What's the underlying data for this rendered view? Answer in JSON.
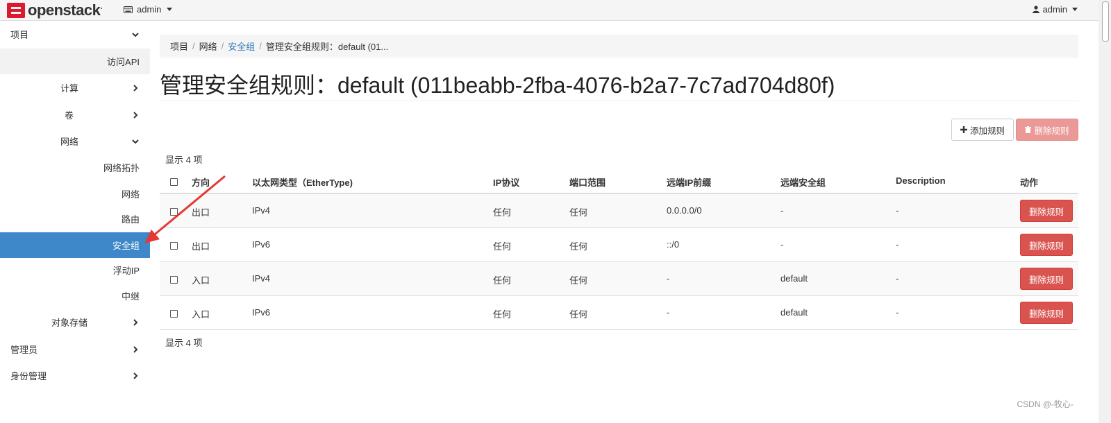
{
  "topbar": {
    "logo_text": "openstack",
    "project": "admin",
    "user": "admin"
  },
  "sidebar": {
    "items": [
      {
        "label": "项目"
      },
      {
        "label": "访问API"
      },
      {
        "label": "计算"
      },
      {
        "label": "卷"
      },
      {
        "label": "网络"
      },
      {
        "label": "网络拓扑"
      },
      {
        "label": "网络"
      },
      {
        "label": "路由"
      },
      {
        "label": "安全组"
      },
      {
        "label": "浮动IP"
      },
      {
        "label": "中继"
      },
      {
        "label": "对象存储"
      },
      {
        "label": "管理员"
      },
      {
        "label": "身份管理"
      }
    ]
  },
  "breadcrumb": {
    "items": [
      "项目",
      "网络",
      "安全组",
      "管理安全组规则：default (01..."
    ]
  },
  "page_title": "管理安全组规则：default (011beabb-2fba-4076-b2a7-7c7ad704d80f)",
  "actions": {
    "add_rule": "添加规则",
    "delete_rules": "删除规则"
  },
  "count_text": "显示 4 项",
  "table": {
    "headers": [
      "方向",
      "以太网类型（EtherType)",
      "IP协议",
      "端口范围",
      "远端IP前缀",
      "远端安全组",
      "Description",
      "动作"
    ],
    "rows": [
      {
        "direction": "出口",
        "ethertype": "IPv4",
        "protocol": "任何",
        "port_range": "任何",
        "remote_ip": "0.0.0.0/0",
        "remote_group": "-",
        "description": "-",
        "action": "删除规则"
      },
      {
        "direction": "出口",
        "ethertype": "IPv6",
        "protocol": "任何",
        "port_range": "任何",
        "remote_ip": "::/0",
        "remote_group": "-",
        "description": "-",
        "action": "删除规则"
      },
      {
        "direction": "入口",
        "ethertype": "IPv4",
        "protocol": "任何",
        "port_range": "任何",
        "remote_ip": "-",
        "remote_group": "default",
        "description": "-",
        "action": "删除规则"
      },
      {
        "direction": "入口",
        "ethertype": "IPv6",
        "protocol": "任何",
        "port_range": "任何",
        "remote_ip": "-",
        "remote_group": "default",
        "description": "-",
        "action": "删除规则"
      }
    ]
  },
  "colors": {
    "active_nav": "#3e87c9",
    "danger": "#d9534f",
    "annotation_arrow": "#e53935"
  },
  "watermark": "CSDN @-牧心-"
}
